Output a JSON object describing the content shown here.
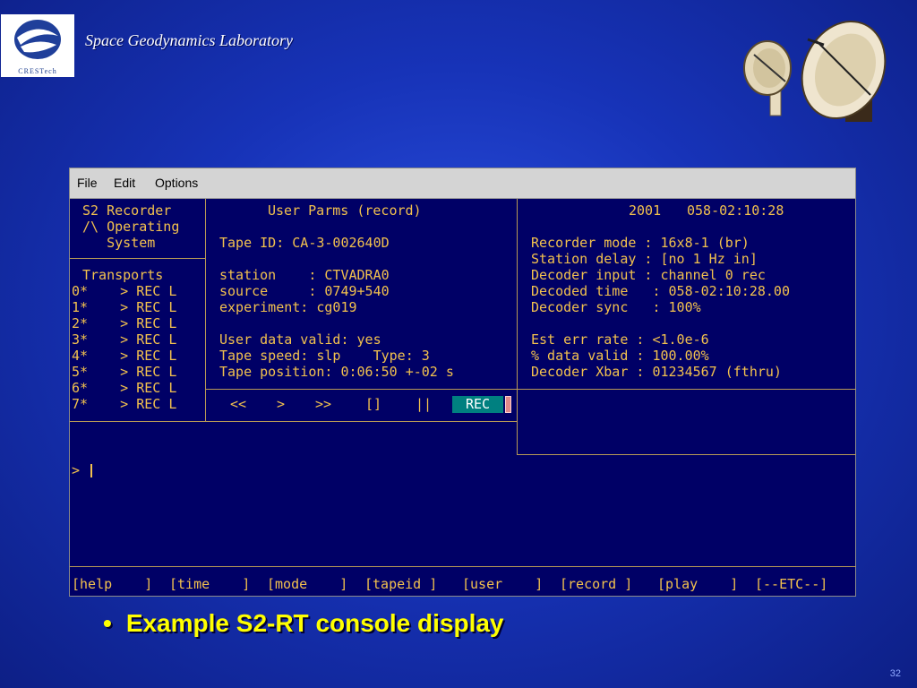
{
  "slide": {
    "logo_text": "CRESTech",
    "lab_title": "Space Geodynamics Laboratory",
    "bullet": "Example S2-RT console display",
    "page_number": "32"
  },
  "menu": {
    "file": "File",
    "edit": "Edit",
    "options": "Options"
  },
  "left": {
    "lines": [
      "S2 Recorder",
      "/\\ Operating",
      "   System"
    ],
    "transports_title": "Transports",
    "transports": [
      "0*    > REC L",
      "1*    > REC L",
      "2*    > REC L",
      "3*    > REC L",
      "4*    > REC L",
      "5*    > REC L",
      "6*    > REC L",
      "7*    > REC L"
    ]
  },
  "middle": {
    "title": "User Parms (record)",
    "tape_id": "Tape ID: CA-3-002640D",
    "station": "station    : CTVADRA0",
    "source": "source     : 0749+540",
    "experiment": "experiment: cg019",
    "user_data_valid": "User data valid: yes",
    "tape_speed": "Tape speed: slp    Type: 3",
    "tape_position": "Tape position: 0:06:50 +-02 s"
  },
  "controls": {
    "rewind": "<<",
    "play": ">",
    "ffwd": ">>",
    "stop": "[]",
    "pause": "||",
    "record": "REC"
  },
  "right": {
    "year": "2001",
    "time": "058-02:10:28",
    "lines": [
      "Recorder mode : 16x8-1 (br)",
      "Station delay : [no 1 Hz in]",
      "Decoder input : channel 0 rec",
      "Decoded time   : 058-02:10:28.00",
      "Decoder sync   : 100%",
      "",
      "Est err rate : <1.0e-6",
      "% data valid : 100.00%",
      "Decoder Xbar : 01234567 (fthru)"
    ]
  },
  "prompt": ">",
  "function_keys": [
    "[help    ]",
    "[time    ]",
    "[mode    ]",
    "[tapeid ]",
    "[user    ]",
    "[record ]",
    "[play    ]",
    "[--ETC--]"
  ]
}
